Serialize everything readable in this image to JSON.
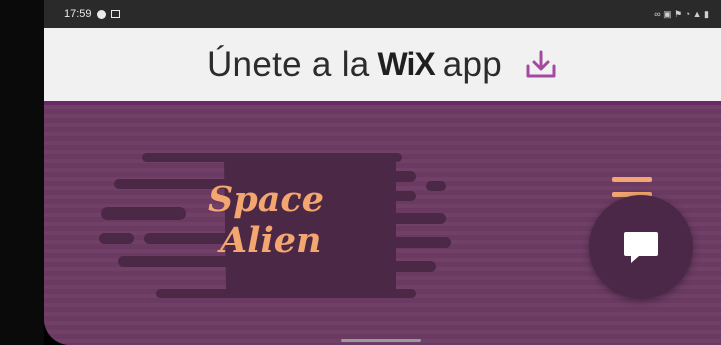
{
  "status_bar": {
    "time": "17:59",
    "right_text": "∞ ▣ ⚑ ◔ ▲ ▮"
  },
  "banner": {
    "prefix": "Únete a la",
    "brand": "WiX",
    "suffix": "app"
  },
  "logo": {
    "line1": "Space",
    "line2": "Alien"
  },
  "colors": {
    "banner_bg": "#f1f1f1",
    "accent": "#a34aa0",
    "page_bg": "#6b3a62",
    "logo_bg": "#4a2846",
    "logo_text": "#f3a670",
    "chat_bg": "#4c2848"
  },
  "icons": {
    "download": "download-icon",
    "menu": "hamburger-menu-icon",
    "chat": "chat-icon"
  }
}
